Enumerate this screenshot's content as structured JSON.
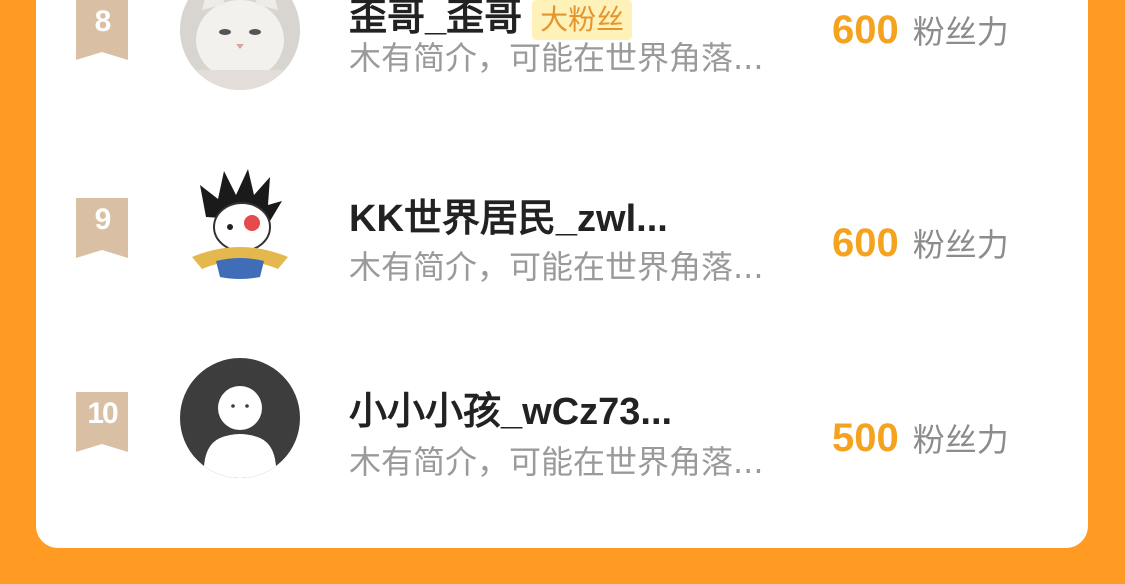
{
  "colors": {
    "page_background": "#FF9A22",
    "score_color": "#F5A31F",
    "badge_background": "#FFF2B8",
    "rank_tag_color": "#D9BFA3"
  },
  "rows": [
    {
      "rank": "8",
      "name": "歪哥_歪哥",
      "badge": "大粉丝",
      "intro": "木有简介，可能在世界角落...",
      "score": "600",
      "score_unit": "粉丝力",
      "avatar": "cat-avatar"
    },
    {
      "rank": "9",
      "name": "KK世界居民_zwl...",
      "badge": "",
      "intro": "木有简介，可能在世界角落...",
      "score": "600",
      "score_unit": "粉丝力",
      "avatar": "cartoon-avatar"
    },
    {
      "rank": "10",
      "name": "小小小孩_wCz73...",
      "badge": "",
      "intro": "木有简介，可能在世界角落...",
      "score": "500",
      "score_unit": "粉丝力",
      "avatar": "default-user-avatar"
    }
  ]
}
